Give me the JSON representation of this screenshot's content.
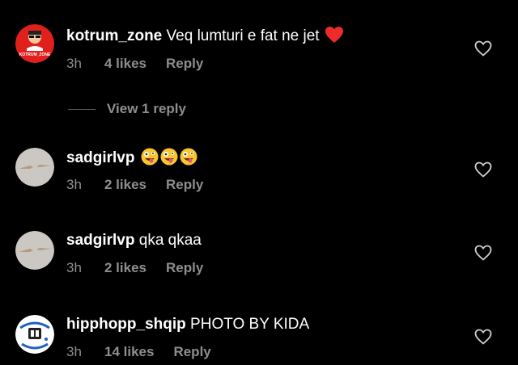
{
  "comments": [
    {
      "username": "kotrum_zone",
      "text": "Veq lumturi e fat ne jet",
      "emoji": "red-heart",
      "time": "3h",
      "likes": "4 likes",
      "reply": "Reply",
      "avatar_text": "KOTRUM_ZONE",
      "view_replies": "View 1 reply"
    },
    {
      "username": "sadgirlvp",
      "text": "",
      "emoji": "zany-face x3",
      "time": "3h",
      "likes": "2 likes",
      "reply": "Reply"
    },
    {
      "username": "sadgirlvp",
      "text": "qka qkaa",
      "time": "3h",
      "likes": "2 likes",
      "reply": "Reply"
    },
    {
      "username": "hipphopp_shqip",
      "text": "PHOTO BY KIDA",
      "time": "3h",
      "likes": "14 likes",
      "reply": "Reply"
    }
  ],
  "icons": {
    "like": "heart-outline-icon"
  },
  "colors": {
    "background": "#000000",
    "primary_text": "#ffffff",
    "secondary_text": "#8e8e8e",
    "kotrum_avatar": "#e0201c"
  }
}
